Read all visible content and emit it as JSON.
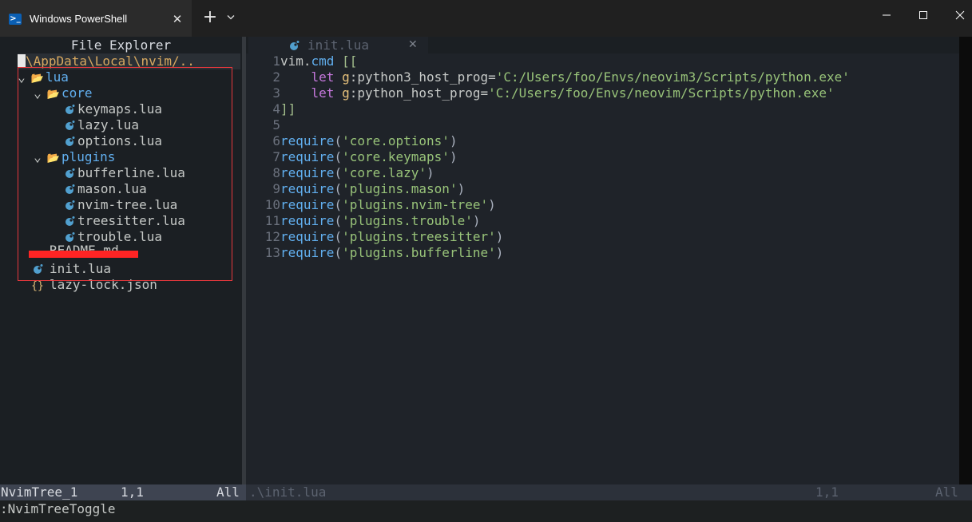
{
  "window": {
    "tab_title": "Windows PowerShell",
    "tab_icon": "powershell-icon",
    "close_tab_glyph": "✕",
    "new_tab_glyph": "+"
  },
  "tree": {
    "header": "File Explorer",
    "root_path": "\\AppData\\Local\\nvim/..",
    "root_prefix": "~",
    "items": [
      {
        "kind": "folder",
        "label": "lua",
        "expanded": true,
        "chev": "⌄"
      },
      {
        "kind": "folder",
        "label": "core",
        "expanded": true,
        "chev": "⌄"
      },
      {
        "kind": "file",
        "label": "keymaps.lua",
        "icon": "lua-icon"
      },
      {
        "kind": "file",
        "label": "lazy.lua",
        "icon": "lua-icon"
      },
      {
        "kind": "file",
        "label": "options.lua",
        "icon": "lua-icon"
      },
      {
        "kind": "folder",
        "label": "plugins",
        "expanded": true,
        "chev": "⌄"
      },
      {
        "kind": "file",
        "label": "bufferline.lua",
        "icon": "lua-icon"
      },
      {
        "kind": "file",
        "label": "mason.lua",
        "icon": "lua-icon"
      },
      {
        "kind": "file",
        "label": "nvim-tree.lua",
        "icon": "lua-icon"
      },
      {
        "kind": "file",
        "label": "treesitter.lua",
        "icon": "lua-icon"
      },
      {
        "kind": "file",
        "label": "trouble.lua",
        "icon": "lua-icon"
      },
      {
        "kind": "file",
        "label": "README.md",
        "icon": "markdown-icon"
      },
      {
        "kind": "file",
        "label": "init.lua",
        "icon": "lua-icon"
      },
      {
        "kind": "file",
        "label": "lazy-lock.json",
        "icon": "json-icon"
      }
    ]
  },
  "editor": {
    "buffer_tab": "init.lua",
    "buffer_tab_close": "✕",
    "lines": [
      {
        "n": "1",
        "tokens": [
          [
            "plain",
            "vim."
          ],
          [
            "fn",
            "cmd"
          ],
          [
            "plain",
            " "
          ],
          [
            "bracket",
            "[["
          ]
        ]
      },
      {
        "n": "2",
        "tokens": [
          [
            "plain",
            "    "
          ],
          [
            "kw",
            "let"
          ],
          [
            "plain",
            " "
          ],
          [
            "var",
            "g"
          ],
          [
            "plain",
            ":python3_host_prog="
          ],
          [
            "str",
            "'C:/Users/foo/Envs/neovim3/Scripts/python.exe'"
          ]
        ]
      },
      {
        "n": "3",
        "tokens": [
          [
            "plain",
            "    "
          ],
          [
            "kw",
            "let"
          ],
          [
            "plain",
            " "
          ],
          [
            "var",
            "g"
          ],
          [
            "plain",
            ":python_host_prog="
          ],
          [
            "str",
            "'C:/Users/foo/Envs/neovim/Scripts/python.exe'"
          ]
        ]
      },
      {
        "n": "4",
        "tokens": [
          [
            "bracket",
            "]]"
          ]
        ]
      },
      {
        "n": "5",
        "tokens": []
      },
      {
        "n": "6",
        "tokens": [
          [
            "fn",
            "require"
          ],
          [
            "punct",
            "("
          ],
          [
            "str",
            "'core.options'"
          ],
          [
            "punct",
            ")"
          ]
        ]
      },
      {
        "n": "7",
        "tokens": [
          [
            "fn",
            "require"
          ],
          [
            "punct",
            "("
          ],
          [
            "str",
            "'core.keymaps'"
          ],
          [
            "punct",
            ")"
          ]
        ]
      },
      {
        "n": "8",
        "tokens": [
          [
            "fn",
            "require"
          ],
          [
            "punct",
            "("
          ],
          [
            "str",
            "'core.lazy'"
          ],
          [
            "punct",
            ")"
          ]
        ]
      },
      {
        "n": "9",
        "tokens": [
          [
            "fn",
            "require"
          ],
          [
            "punct",
            "("
          ],
          [
            "str",
            "'plugins.mason'"
          ],
          [
            "punct",
            ")"
          ]
        ]
      },
      {
        "n": "10",
        "tokens": [
          [
            "fn",
            "require"
          ],
          [
            "punct",
            "("
          ],
          [
            "str",
            "'plugins.nvim-tree'"
          ],
          [
            "punct",
            ")"
          ]
        ]
      },
      {
        "n": "11",
        "tokens": [
          [
            "fn",
            "require"
          ],
          [
            "punct",
            "("
          ],
          [
            "str",
            "'plugins.trouble'"
          ],
          [
            "punct",
            ")"
          ]
        ]
      },
      {
        "n": "12",
        "tokens": [
          [
            "fn",
            "require"
          ],
          [
            "punct",
            "("
          ],
          [
            "str",
            "'plugins.treesitter'"
          ],
          [
            "punct",
            ")"
          ]
        ]
      },
      {
        "n": "13",
        "tokens": [
          [
            "fn",
            "require"
          ],
          [
            "punct",
            "("
          ],
          [
            "str",
            "'plugins.bufferline'"
          ],
          [
            "punct",
            ")"
          ]
        ]
      }
    ]
  },
  "status": {
    "left_name": "NvimTree_1",
    "left_pos": "1,1",
    "left_scroll": "All",
    "right_file": ".\\init.lua",
    "right_pos": "1,1",
    "right_scroll": "All"
  },
  "cmdline": ":NvimTreeToggle",
  "colors": {
    "folder": "#61afef",
    "lua_icon": "#51a0cf",
    "string": "#98c379",
    "keyword": "#c678dd",
    "highlight_box": "#e8383d"
  }
}
